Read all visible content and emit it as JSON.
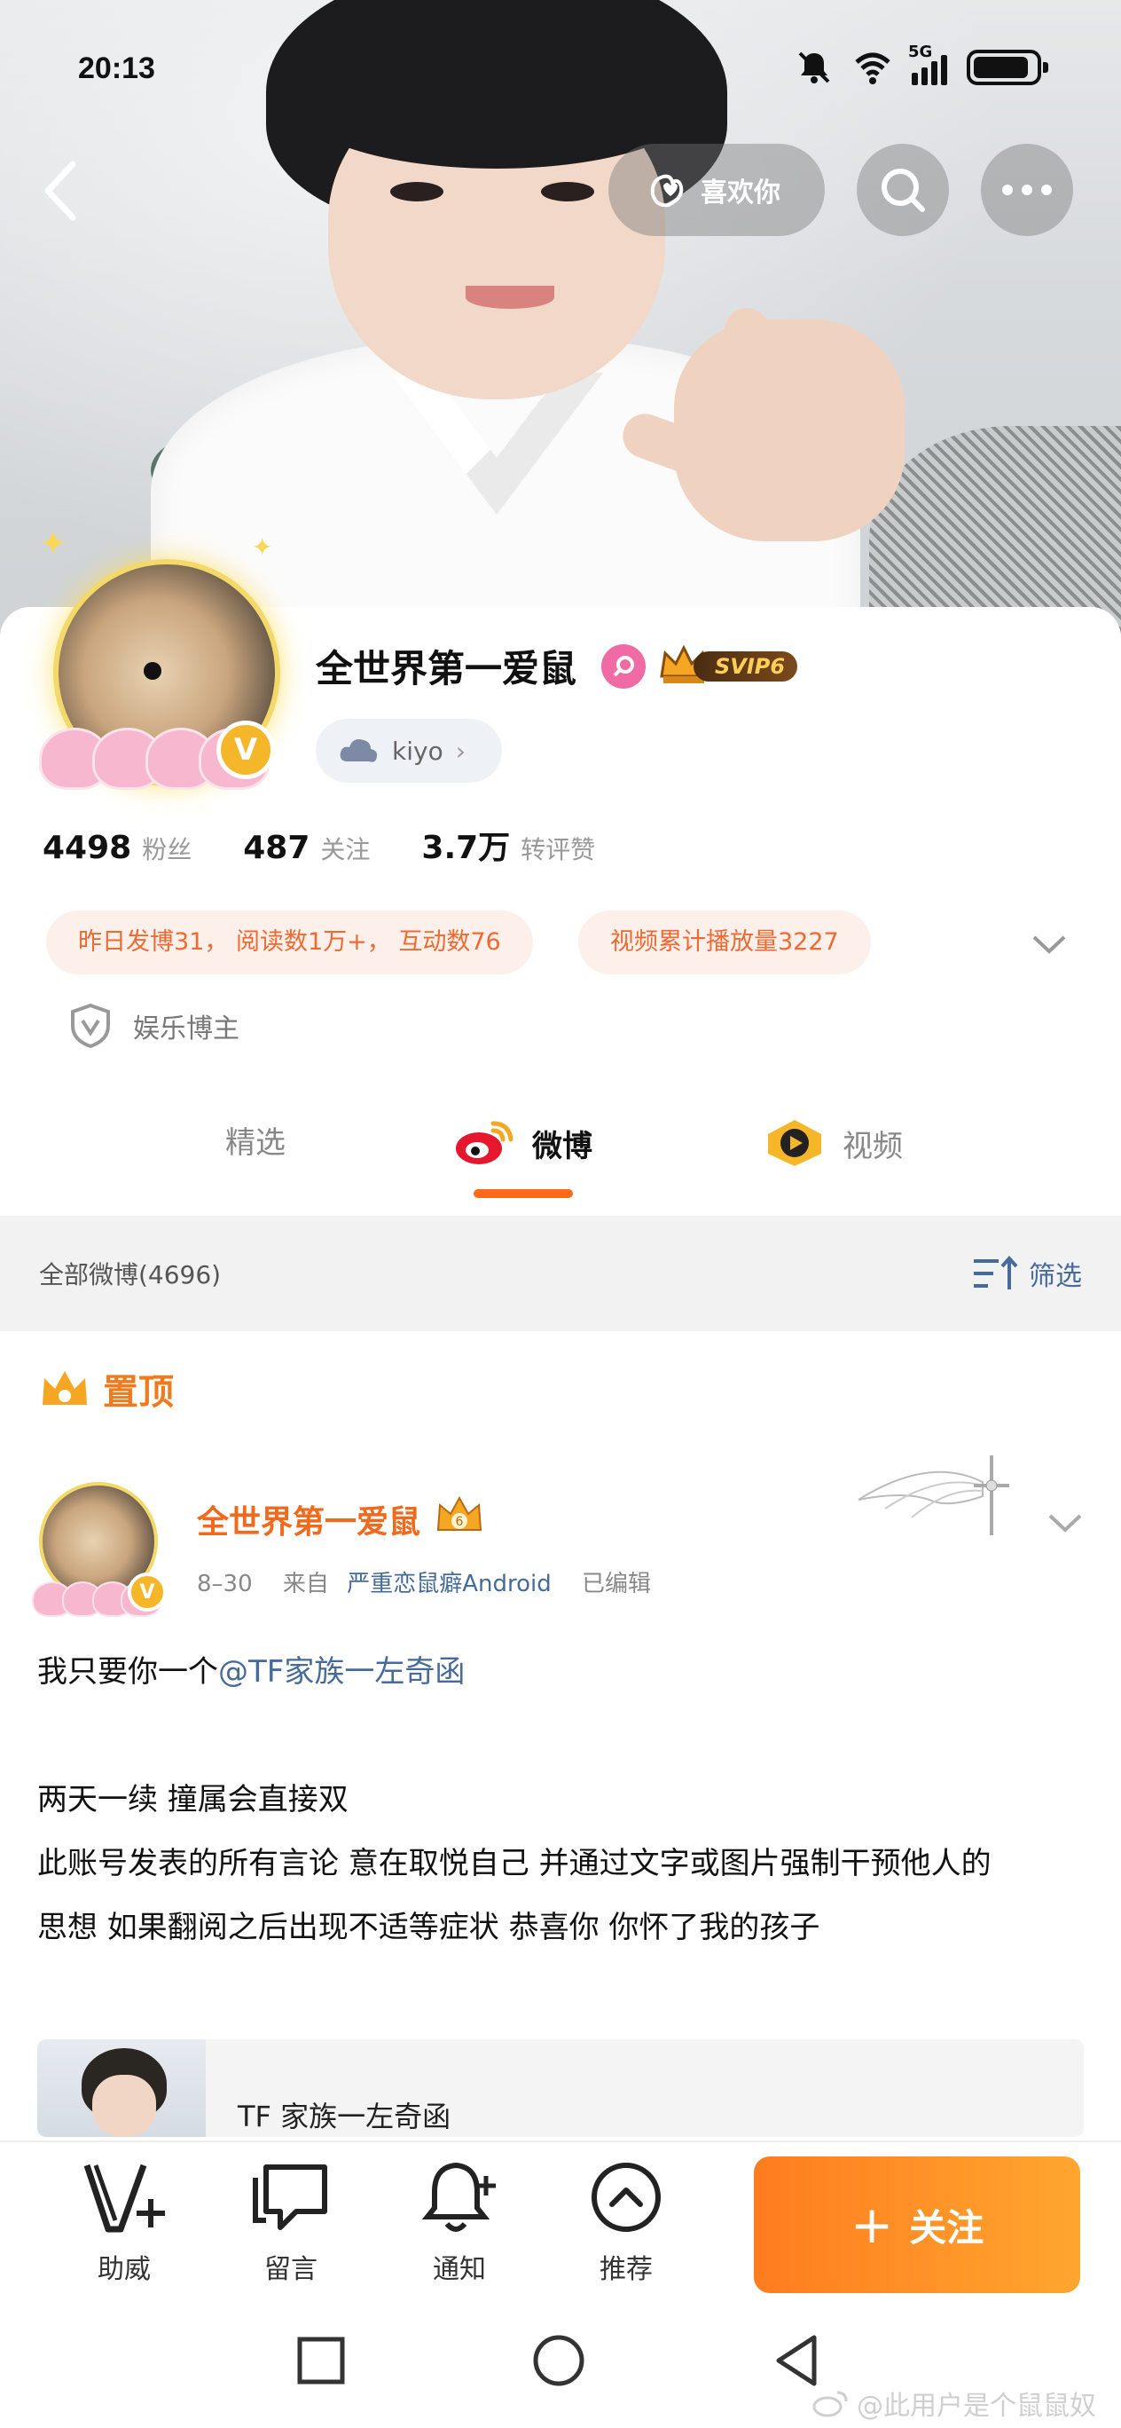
{
  "status_bar": {
    "time": "20:13",
    "network": "5G",
    "battery_level": 0.9
  },
  "header": {
    "like_label": "喜欢你"
  },
  "profile": {
    "name": "全世界第一爱鼠",
    "svip": "SVIP6",
    "tag_label": "kiyo",
    "stats": [
      {
        "num": "4498",
        "label": "粉丝"
      },
      {
        "num": "487",
        "label": "关注"
      },
      {
        "num": "3.7万",
        "label": "转评赞"
      }
    ],
    "pills": [
      "昨日发博31， 阅读数1万+， 互动数76",
      "视频累计播放量3227"
    ],
    "verification": "娱乐博主",
    "verified_badge": "V"
  },
  "tabs": [
    {
      "label": "精选",
      "active": false
    },
    {
      "label": "微博",
      "active": true
    },
    {
      "label": "视频",
      "active": false
    }
  ],
  "filter": {
    "all_label": "全部微博(4696)",
    "filter_label": "筛选"
  },
  "post": {
    "pinned_label": "置顶",
    "author": "全世界第一爱鼠",
    "date": "8–30",
    "from_prefix": "来自",
    "source": "严重恋鼠癖Android",
    "edited": "已编辑",
    "line1_text": "我只要你一个",
    "line1_mention": "@TF家族一左奇函",
    "line2": "两天一续  撞属会直接双",
    "line3": "此账号发表的所有言论  意在取悦自己  并通过文字或图片强制干预他人的",
    "line4": "思想  如果翻阅之后出现不适等症状  恭喜你  你怀了我的孩子",
    "repost_title": "TF 家族一左奇函"
  },
  "bottom_actions": [
    {
      "label": "助威",
      "icon": "cheer-icon"
    },
    {
      "label": "留言",
      "icon": "message-icon"
    },
    {
      "label": "通知",
      "icon": "bell-plus-icon"
    },
    {
      "label": "推荐",
      "icon": "recommend-icon"
    }
  ],
  "follow_label": "关注",
  "watermark": "@此用户是个鼠鼠奴",
  "colors": {
    "accent": "#ff7c1f",
    "link": "#466a9a",
    "pill_bg": "#fdf0ea",
    "pill_text": "#ef6a33"
  }
}
